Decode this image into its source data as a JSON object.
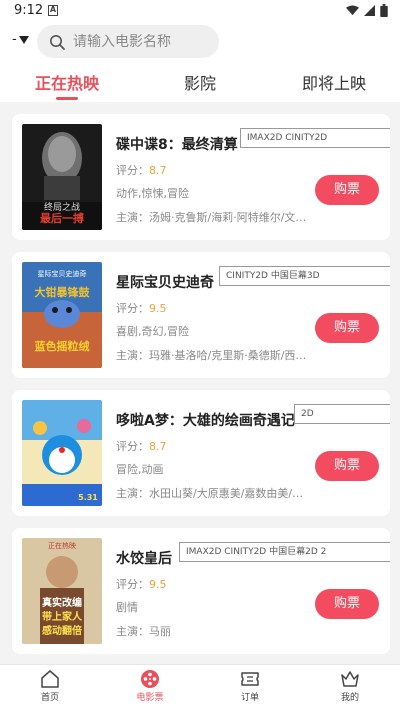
{
  "status_bar": {
    "time": "9:12",
    "notification_icon": "A"
  },
  "search": {
    "city": "-",
    "placeholder": "请输入电影名称"
  },
  "tabs": [
    {
      "label": "正在热映",
      "active": true
    },
    {
      "label": "影院",
      "active": false
    },
    {
      "label": "即将上映",
      "active": false
    }
  ],
  "movies": [
    {
      "title": "碟中谍8：最终清算",
      "tags": "IMAX2D CINITY2D",
      "score_label": "评分：",
      "score": "8.7",
      "genre": "动作,惊悚,冒险",
      "cast": "主演：汤姆·克鲁斯/海莉·阿特维尔/文…",
      "buy_label": "购票",
      "poster_text": [
        "终局之战",
        "最后一搏"
      ]
    },
    {
      "title": "星际宝贝史迪奇",
      "tags": "CINITY2D 中国巨幕3D",
      "score_label": "评分：",
      "score": "9.5",
      "genre": "喜剧,奇幻,冒险",
      "cast": "主演：玛雅·基洛哈/克里斯·桑德斯/西…",
      "buy_label": "购票",
      "poster_text": [
        "星际宝贝史迪奇",
        "大钳暴锋鼓",
        "蓝色摇粒绒"
      ]
    },
    {
      "title": "哆啦A梦：大雄的绘画奇遇记",
      "tags": "2D",
      "score_label": "评分：",
      "score": "8.7",
      "genre": "冒险,动画",
      "cast": "主演：水田山葵/大原惠美/嘉数由美/木…",
      "buy_label": "购票",
      "poster_text": [
        "5.31"
      ]
    },
    {
      "title": "水饺皇后",
      "tags": "IMAX2D CINITY2D 中国巨幕2D 2",
      "score_label": "评分：",
      "score": "9.5",
      "genre": "剧情",
      "cast": "主演：马丽",
      "buy_label": "购票",
      "poster_text": [
        "正在热映",
        "真实改编",
        "带上家人",
        "感动翻倍"
      ]
    }
  ],
  "bottom_nav": [
    {
      "label": "首页",
      "icon": "home-icon",
      "active": false
    },
    {
      "label": "电影票",
      "icon": "film-reel-icon",
      "active": true
    },
    {
      "label": "订单",
      "icon": "ticket-icon",
      "active": false
    },
    {
      "label": "我的",
      "icon": "crown-icon",
      "active": false
    }
  ],
  "colors": {
    "accent": "#e8505b",
    "buy_button": "#f34b5f",
    "score": "#e8a33b"
  }
}
